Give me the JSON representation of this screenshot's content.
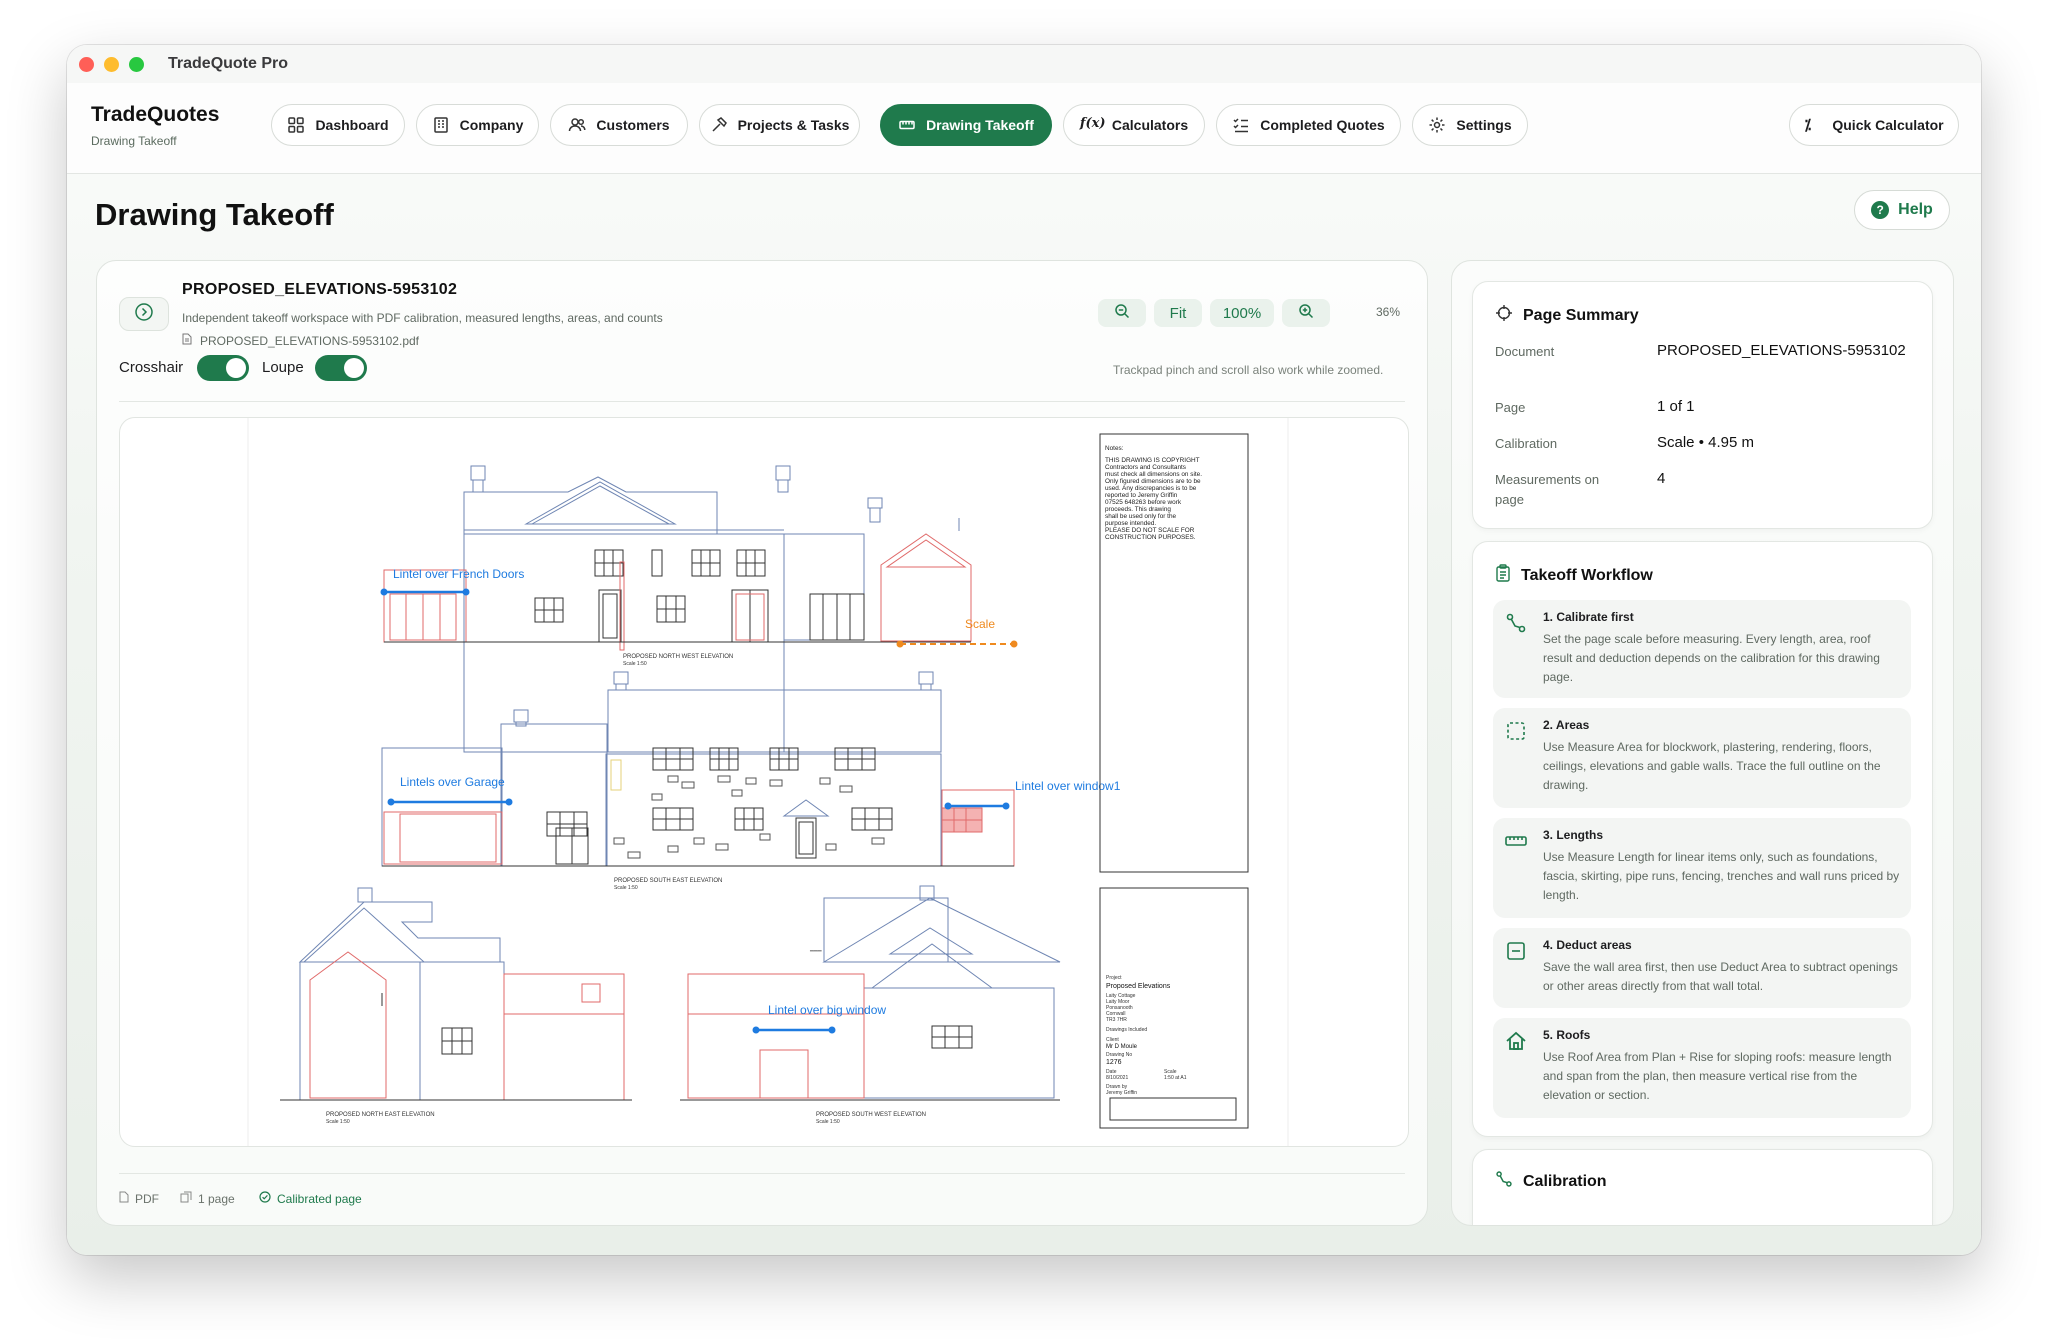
{
  "window": {
    "title": "TradeQuote Pro"
  },
  "brand": {
    "title": "TradeQuotes",
    "subtitle": "Drawing Takeoff"
  },
  "nav": {
    "dashboard": "Dashboard",
    "company": "Company",
    "customers": "Customers",
    "projects": "Projects & Tasks",
    "drawing_takeoff": "Drawing Takeoff",
    "calculators": "Calculators",
    "completed_quotes": "Completed Quotes",
    "settings": "Settings",
    "quick_calculator": "Quick Calculator",
    "active": "drawing_takeoff"
  },
  "page": {
    "title": "Drawing Takeoff",
    "help_label": "Help"
  },
  "document": {
    "name": "PROPOSED_ELEVATIONS-5953102",
    "description": "Independent takeoff workspace with PDF calibration, measured lengths, areas, and counts",
    "filename": "PROPOSED_ELEVATIONS-5953102.pdf"
  },
  "zoom": {
    "fit_label": "Fit",
    "actual_label": "100%",
    "current": "36%"
  },
  "toggles": {
    "crosshair_label": "Crosshair",
    "crosshair_on": true,
    "loupe_label": "Loupe",
    "loupe_on": true
  },
  "trackpad_note": "Trackpad pinch and scroll also work while zoomed.",
  "drawing": {
    "measurements": {
      "m1": "Lintel over French Doors",
      "m2": "Scale",
      "m3": "Lintels over Garage",
      "m4": "Lintel over window1",
      "m5": "Lintel over big window"
    },
    "elevations": {
      "nw": "PROPOSED NORTH WEST ELEVATION",
      "se": "PROPOSED SOUTH EAST ELEVATION",
      "ne": "PROPOSED NORTH EAST ELEVATION",
      "sw": "PROPOSED SOUTH WEST ELEVATION",
      "scale": "Scale 1:50"
    },
    "notes": [
      "Notes:",
      "THIS DRAWING IS COPYRIGHT",
      "Contractors and Consultants",
      "must check all dimensions on site.",
      "Only figured dimensions are to be",
      "used. Any discrepancies is to be",
      "reported to Jeremy Griffin",
      "07525 648263 before work",
      "proceeds. This drawing",
      "shall be used only for the",
      "purpose intended.",
      "PLEASE DO NOT SCALE FOR",
      "CONSTRUCTION PURPOSES."
    ],
    "title_block": {
      "project_label": "Project",
      "project": "Proposed Elevations",
      "address": [
        "Laity Cottage",
        "Laity Moor",
        "Ponsanooth",
        "Cornwall",
        "TR3 7HR"
      ],
      "drawings_label": "Drawings Included",
      "client_label": "Client",
      "client": "Mr D Moule",
      "drawing_no_label": "Drawing No",
      "drawing_no": "1276",
      "date_label": "Date",
      "date": "8/10/2021",
      "scale_label": "Scale",
      "scale": "1:50 at A1",
      "drawn_label": "Drawn by",
      "drawn": "Jeremy Griffin"
    }
  },
  "footer": {
    "type": "PDF",
    "pages": "1 page",
    "status": "Calibrated page"
  },
  "summary": {
    "title": "Page Summary",
    "document_label": "Document",
    "document_value": "PROPOSED_ELEVATIONS-5953102",
    "page_label": "Page",
    "page_value": "1 of 1",
    "calibration_label": "Calibration",
    "calibration_value": "Scale • 4.95 m",
    "measurements_label": "Measurements on page",
    "measurements_value": "4"
  },
  "workflow": {
    "title": "Takeoff Workflow",
    "steps": [
      {
        "title": "1. Calibrate first",
        "body": "Set the page scale before measuring. Every length, area, roof result and deduction depends on the calibration for this drawing page.",
        "icon": "calibrate-icon"
      },
      {
        "title": "2. Areas",
        "body": "Use Measure Area for blockwork, plastering, rendering, floors, ceilings, elevations and gable walls. Trace the full outline on the drawing.",
        "icon": "area-icon"
      },
      {
        "title": "3. Lengths",
        "body": "Use Measure Length for linear items only, such as foundations, fascia, skirting, pipe runs, fencing, trenches and wall runs priced by length.",
        "icon": "ruler-icon"
      },
      {
        "title": "4. Deduct areas",
        "body": "Save the wall area first, then use Deduct Area to subtract openings or other areas directly from that wall total.",
        "icon": "deduct-icon"
      },
      {
        "title": "5. Roofs",
        "body": "Use Roof Area from Plan + Rise for sloping roofs: measure length and span from the plan, then measure vertical rise from the elevation or section.",
        "icon": "house-icon"
      }
    ]
  },
  "calibration_card": {
    "title": "Calibration"
  },
  "colors": {
    "accent": "#1f7a4c",
    "measure_blue": "#1e7be0",
    "scale_orange": "#ef8a1f",
    "drawing_red": "#e06a6a",
    "drawing_blue": "#6f86b3"
  }
}
